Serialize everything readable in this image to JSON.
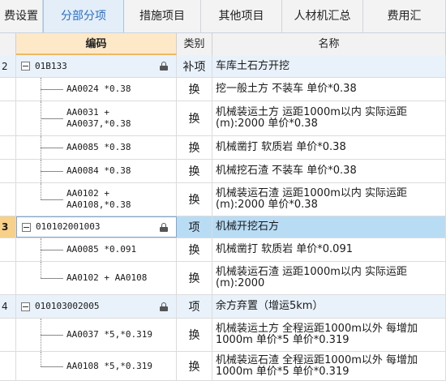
{
  "tabs": [
    {
      "label": "费设置",
      "active": false
    },
    {
      "label": "分部分项",
      "active": true
    },
    {
      "label": "措施项目",
      "active": false
    },
    {
      "label": "其他项目",
      "active": false
    },
    {
      "label": "人材机汇总",
      "active": false
    },
    {
      "label": "费用汇",
      "active": false
    }
  ],
  "columns": {
    "code": "编码",
    "type": "类别",
    "name": "名称"
  },
  "groups": [
    {
      "index": "2",
      "code": "01B133",
      "type": "补项",
      "name": "车库土石方开挖",
      "children": [
        {
          "code": "AA0024 *0.38",
          "type": "换",
          "name": "挖一般土方 不装车  单价*0.38"
        },
        {
          "code": "AA0031 +\nAA0037,*0.38",
          "type": "换",
          "name": "机械装运土方 运距1000m以内  实际运距(m):2000  单价*0.38"
        },
        {
          "code": "AA0085 *0.38",
          "type": "换",
          "name": "机械凿打 软质岩  单价*0.38"
        },
        {
          "code": "AA0084 *0.38",
          "type": "换",
          "name": "机械挖石渣 不装车  单价*0.38"
        },
        {
          "code": "AA0102 +\nAA0108,*0.38",
          "type": "换",
          "name": "机械装运石渣 运距1000m以内  实际运距(m):2000  单价*0.38"
        }
      ]
    },
    {
      "index": "3",
      "code": "010102001003",
      "type": "项",
      "name": "机械开挖石方",
      "selected": true,
      "children": [
        {
          "code": "AA0085 *0.091",
          "type": "换",
          "name": "机械凿打 软质岩  单价*0.091"
        },
        {
          "code": "AA0102 + AA0108",
          "type": "换",
          "name": "机械装运石渣 运距1000m以内  实际运距(m):2000"
        }
      ]
    },
    {
      "index": "4",
      "code": "010103002005",
      "type": "项",
      "name": "余方弃置（增运5km）",
      "children": [
        {
          "code": "AA0037 *5,*0.319",
          "type": "换",
          "name": "机械装运土方 全程运距1000m以外 每增加1000m  单价*5  单价*0.319"
        },
        {
          "code": "AA0108 *5,*0.319",
          "type": "换",
          "name": "机械装运石渣 全程运距1000m以外 每增加1000m  单价*5  单价*0.319"
        }
      ]
    }
  ]
}
